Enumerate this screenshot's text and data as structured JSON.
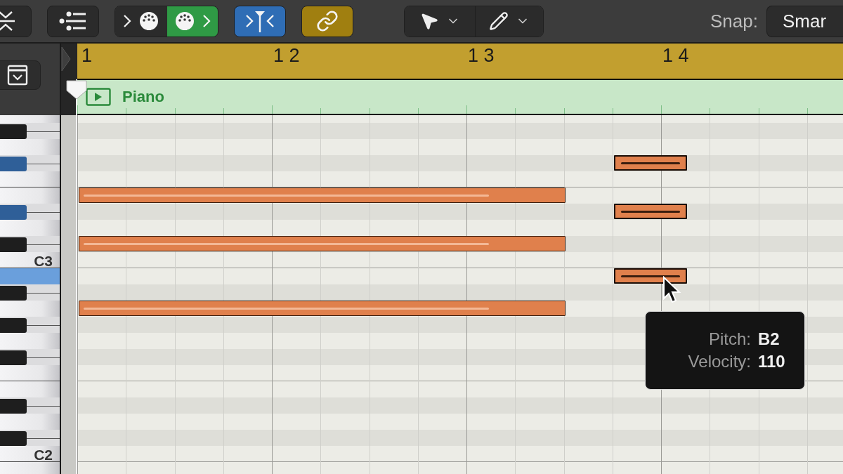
{
  "toolbar": {
    "buttons": [
      {
        "kind": "collapse"
      },
      {
        "kind": "list"
      },
      {
        "kind": "midi_in",
        "on": false
      },
      {
        "kind": "midi_out",
        "on": true
      },
      {
        "kind": "filter",
        "on": true
      },
      {
        "kind": "link",
        "on": true
      }
    ],
    "tools": [
      {
        "kind": "pointer"
      },
      {
        "kind": "pencil"
      }
    ],
    "snap": {
      "label": "Snap:",
      "value": "Smar"
    }
  },
  "ruler": {
    "bars": [
      {
        "label": "1"
      },
      {
        "label": "1 2"
      },
      {
        "label": "1 3"
      },
      {
        "label": "1 4"
      }
    ]
  },
  "region": {
    "name": "Piano"
  },
  "keyboard": {
    "keys": [
      {
        "kind": "white",
        "selected": false
      },
      {
        "kind": "black",
        "selected": false
      },
      {
        "kind": "white",
        "selected": false
      },
      {
        "kind": "black",
        "selected": true
      },
      {
        "kind": "white",
        "selected": false
      },
      {
        "kind": "white",
        "selected": false
      },
      {
        "kind": "black",
        "selected": true
      },
      {
        "kind": "white",
        "selected": false
      },
      {
        "kind": "black",
        "selected": false
      },
      {
        "kind": "white",
        "selected": false,
        "label": "C3"
      },
      {
        "kind": "white",
        "selected": true
      },
      {
        "kind": "black",
        "selected": false
      },
      {
        "kind": "white",
        "selected": false
      },
      {
        "kind": "black",
        "selected": false
      },
      {
        "kind": "white",
        "selected": false
      },
      {
        "kind": "black",
        "selected": false
      },
      {
        "kind": "white",
        "selected": false
      },
      {
        "kind": "white",
        "selected": false
      },
      {
        "kind": "black",
        "selected": false
      },
      {
        "kind": "white",
        "selected": false
      },
      {
        "kind": "black",
        "selected": false
      },
      {
        "kind": "white",
        "selected": false,
        "label": "C2"
      },
      {
        "kind": "white",
        "selected": false
      }
    ]
  },
  "notes": [
    {
      "selected": false
    },
    {
      "selected": false
    },
    {
      "selected": false
    },
    {
      "selected": true
    },
    {
      "selected": true
    },
    {
      "selected": true
    }
  ],
  "tooltip": {
    "rows": [
      {
        "label": "Pitch:",
        "value": "B2"
      },
      {
        "label": "Velocity:",
        "value": "110"
      }
    ]
  }
}
